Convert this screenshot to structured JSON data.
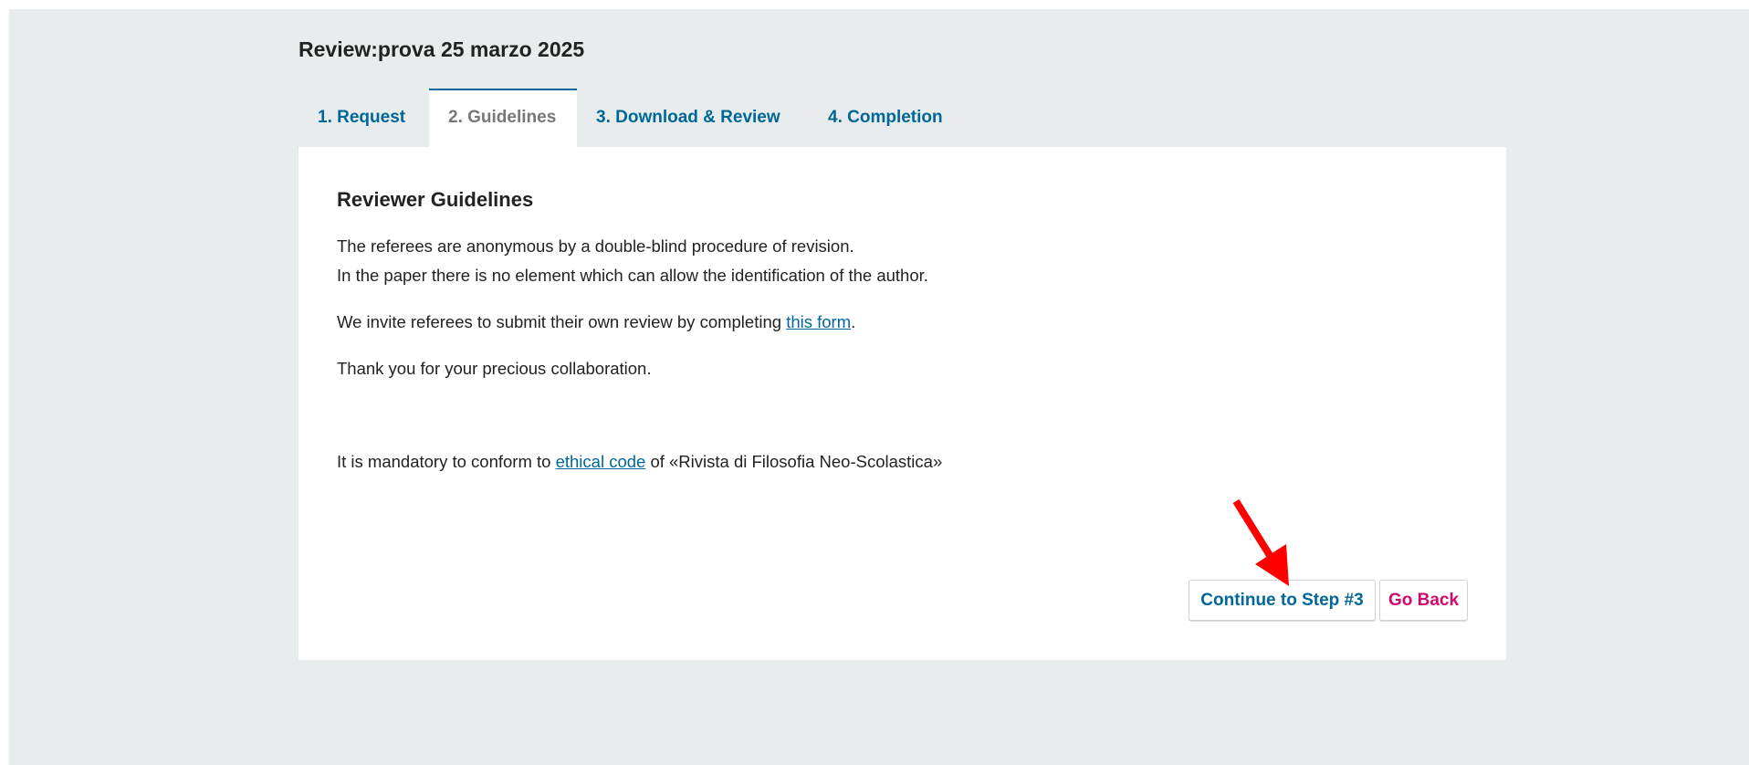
{
  "page": {
    "title": "Review:prova 25 marzo 2025"
  },
  "tabs": [
    {
      "label": "1. Request",
      "active": false
    },
    {
      "label": "2. Guidelines",
      "active": true
    },
    {
      "label": "3. Download & Review",
      "active": false
    },
    {
      "label": "4. Completion",
      "active": false
    }
  ],
  "guidelines": {
    "heading": "Reviewer Guidelines",
    "line1": "The referees are anonymous by a double-blind procedure of revision.",
    "line2": "In the paper there is no element which can allow the identification of the author.",
    "line3_before": "We invite referees to submit their own review by completing ",
    "line3_link": "this form",
    "line3_after": ".",
    "line4": "Thank you for your precious collaboration.",
    "line5_before": "It is mandatory to conform to ",
    "line5_link": "ethical code",
    "line5_after": " of «Rivista di Filosofia Neo-Scolastica»"
  },
  "actions": {
    "continue_label": "Continue to Step #3",
    "back_label": "Go Back"
  },
  "colors": {
    "link": "#006798",
    "back_button": "#d00a6c",
    "annotation_arrow": "#ff0000",
    "background": "#e8ecec"
  }
}
